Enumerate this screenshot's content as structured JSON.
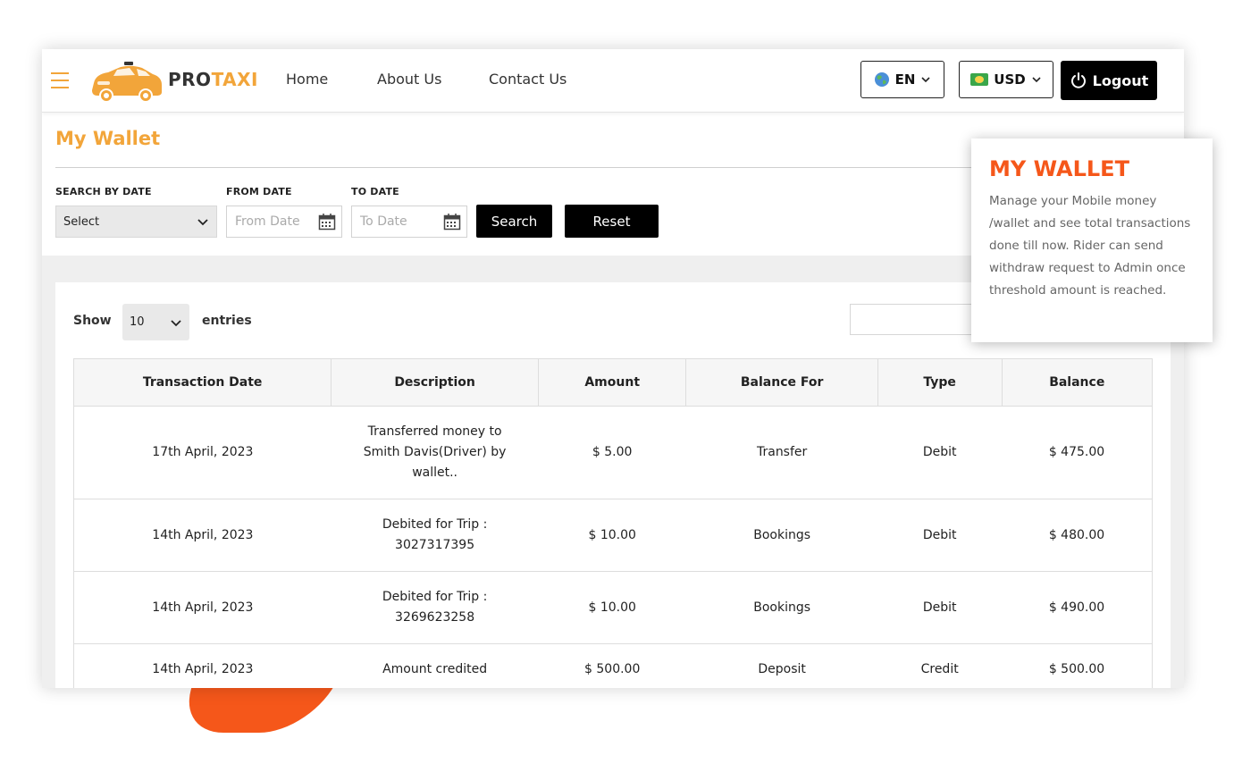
{
  "header": {
    "brand_part1": "PRO",
    "brand_part2": "TAXI",
    "nav": [
      "Home",
      "About Us",
      "Contact Us"
    ],
    "language": "EN",
    "currency": "USD",
    "logout_label": "Logout"
  },
  "page": {
    "title": "My Wallet"
  },
  "filters": {
    "search_by_date_label": "SEARCH BY DATE",
    "search_by_date_value": "Select",
    "from_date_label": "FROM DATE",
    "from_date_placeholder": "From Date",
    "to_date_label": "TO DATE",
    "to_date_placeholder": "To Date",
    "search_button": "Search",
    "reset_button": "Reset"
  },
  "table_controls": {
    "show_label": "Show",
    "entries_value": "10",
    "entries_label": "entries"
  },
  "table": {
    "headers": [
      "Transaction Date",
      "Description",
      "Amount",
      "Balance For",
      "Type",
      "Balance"
    ],
    "rows": [
      [
        "17th April, 2023",
        "Transferred money to\nSmith Davis(Driver) by\nwallet..",
        "$ 5.00",
        "Transfer",
        "Debit",
        "$ 475.00"
      ],
      [
        "14th April, 2023",
        "Debited for Trip :\n3027317395",
        "$ 10.00",
        "Bookings",
        "Debit",
        "$ 480.00"
      ],
      [
        "14th April, 2023",
        "Debited for Trip :\n3269623258",
        "$ 10.00",
        "Bookings",
        "Debit",
        "$ 490.00"
      ],
      [
        "14th April, 2023",
        "Amount credited",
        "$ 500.00",
        "Deposit",
        "Credit",
        "$ 500.00"
      ]
    ]
  },
  "callout": {
    "title": "MY WALLET",
    "text": "Manage your Mobile money /wallet and see total transactions done till now. Rider can send withdraw request to Admin once threshold amount is reached."
  },
  "colors": {
    "brand_yellow": "#f2a53a",
    "accent_orange": "#f5571a",
    "button_black": "#000000"
  },
  "icons": [
    "hamburger-icon",
    "taxi-logo",
    "globe-icon",
    "flag-icon",
    "power-icon",
    "calendar-icon",
    "chevron-down-icon"
  ]
}
